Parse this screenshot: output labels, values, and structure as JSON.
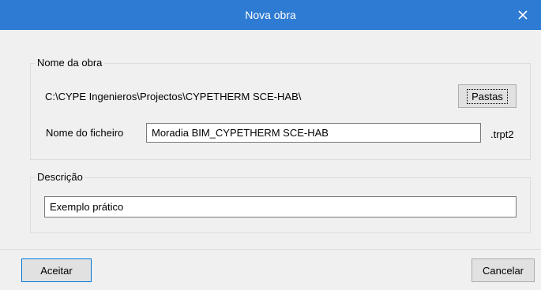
{
  "dialog": {
    "title": "Nova obra",
    "close_icon": "close-icon"
  },
  "nome_da_obra": {
    "legend": "Nome da obra",
    "path": "C:\\CYPE Ingenieros\\Projectos\\CYPETHERM SCE-HAB\\",
    "pastas_label": "Pastas",
    "file_label": "Nome do ficheiro",
    "file_value": "Moradia BIM_CYPETHERM SCE-HAB",
    "extension": ".trpt2"
  },
  "descricao": {
    "legend": "Descrição",
    "value": "Exemplo prático"
  },
  "buttons": {
    "accept_label": "Aceitar",
    "cancel_label": "Cancelar"
  },
  "colors": {
    "titlebar": "#2e7bd3",
    "focus_border": "#0078d7"
  }
}
